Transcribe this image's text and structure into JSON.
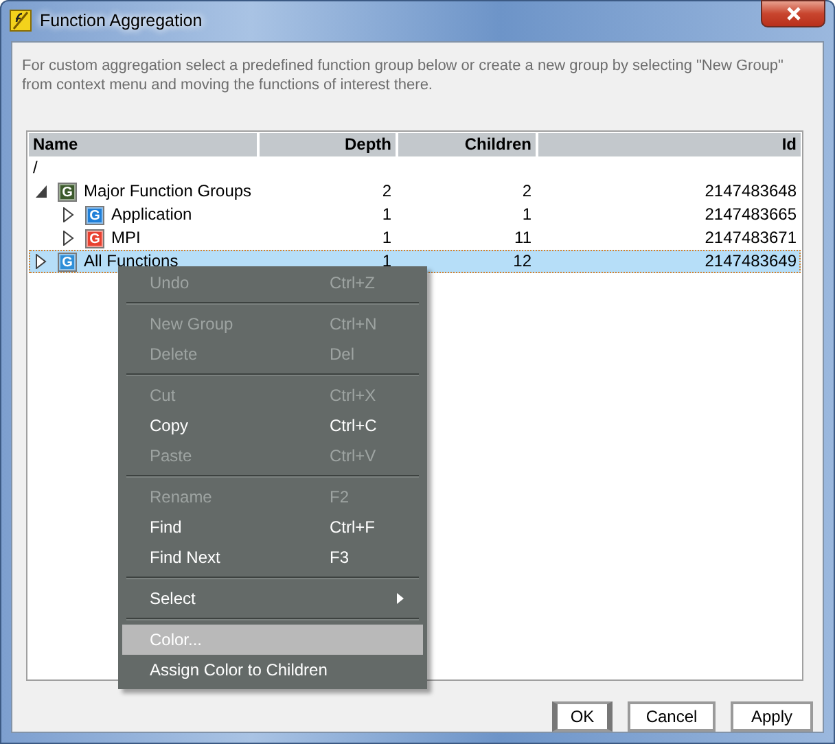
{
  "window": {
    "title": "Function Aggregation"
  },
  "description": "For custom aggregation select a predefined function group below or create a new group by selecting \"New Group\" from context menu and moving the functions of interest there.",
  "table": {
    "columns": [
      "Name",
      "Depth",
      "Children",
      "Id"
    ],
    "root": {
      "name": "/",
      "children": [
        {
          "name": "Major Function Groups",
          "badge": "G",
          "color": "#3c5a2c",
          "depth": "2",
          "children_count": "2",
          "id": "2147483648",
          "expanded": true,
          "selected": false,
          "children": [
            {
              "name": "Application",
              "badge": "G",
              "color": "#1f7fd8",
              "depth": "1",
              "children_count": "1",
              "id": "2147483665",
              "expanded": false,
              "selected": false
            },
            {
              "name": "MPI",
              "badge": "G",
              "color": "#e8402f",
              "depth": "1",
              "children_count": "11",
              "id": "2147483671",
              "expanded": false,
              "selected": false
            }
          ]
        },
        {
          "name": "All Functions",
          "badge": "G",
          "color": "#2f8fd8",
          "depth": "1",
          "children_count": "12",
          "id": "2147483649",
          "expanded": false,
          "selected": true
        }
      ]
    }
  },
  "context_menu": [
    {
      "kind": "item",
      "label": "Undo",
      "shortcut": "Ctrl+Z",
      "disabled": true,
      "selected": false
    },
    {
      "kind": "separator"
    },
    {
      "kind": "item",
      "label": "New Group",
      "shortcut": "Ctrl+N",
      "disabled": true,
      "selected": false
    },
    {
      "kind": "item",
      "label": "Delete",
      "shortcut": "Del",
      "disabled": true,
      "selected": false
    },
    {
      "kind": "separator"
    },
    {
      "kind": "item",
      "label": "Cut",
      "shortcut": "Ctrl+X",
      "disabled": true,
      "selected": false
    },
    {
      "kind": "item",
      "label": "Copy",
      "shortcut": "Ctrl+C",
      "disabled": false,
      "selected": false
    },
    {
      "kind": "item",
      "label": "Paste",
      "shortcut": "Ctrl+V",
      "disabled": true,
      "selected": false
    },
    {
      "kind": "separator"
    },
    {
      "kind": "item",
      "label": "Rename",
      "shortcut": "F2",
      "disabled": true,
      "selected": false
    },
    {
      "kind": "item",
      "label": "Find",
      "shortcut": "Ctrl+F",
      "disabled": false,
      "selected": false
    },
    {
      "kind": "item",
      "label": "Find Next",
      "shortcut": "F3",
      "disabled": false,
      "selected": false
    },
    {
      "kind": "separator"
    },
    {
      "kind": "submenu",
      "label": "Select",
      "disabled": false,
      "selected": false
    },
    {
      "kind": "separator"
    },
    {
      "kind": "item",
      "label": "Color...",
      "disabled": false,
      "selected": true
    },
    {
      "kind": "item",
      "label": "Assign Color to Children",
      "disabled": false,
      "selected": false
    }
  ],
  "buttons": [
    {
      "label": "OK",
      "default": true
    },
    {
      "label": "Cancel",
      "default": false
    },
    {
      "label": "Apply",
      "default": false
    }
  ]
}
